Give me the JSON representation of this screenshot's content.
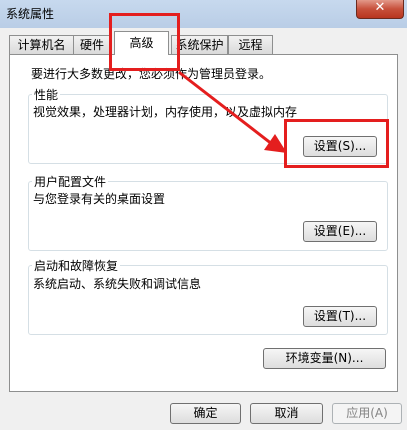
{
  "window": {
    "title": "系统属性",
    "close_glyph": "✕"
  },
  "tabs": [
    {
      "label": "计算机名"
    },
    {
      "label": "硬件"
    },
    {
      "label": "高级",
      "active": true
    },
    {
      "label": "系统保护"
    },
    {
      "label": "远程"
    }
  ],
  "advanced": {
    "intro": "要进行大多数更改，您必须作为管理员登录。",
    "performance": {
      "title": "性能",
      "description": "视觉效果，处理器计划，内存使用，以及虚拟内存",
      "button": "设置(S)..."
    },
    "user_profiles": {
      "title": "用户配置文件",
      "description": "与您登录有关的桌面设置",
      "button": "设置(E)..."
    },
    "startup_recovery": {
      "title": "启动和故障恢复",
      "description": "系统启动、系统失败和调试信息",
      "button": "设置(T)..."
    },
    "env_button": "环境变量(N)..."
  },
  "footer": {
    "ok": "确定",
    "cancel": "取消",
    "apply": "应用(A)"
  },
  "annotation": {
    "color": "#e41e1e"
  }
}
